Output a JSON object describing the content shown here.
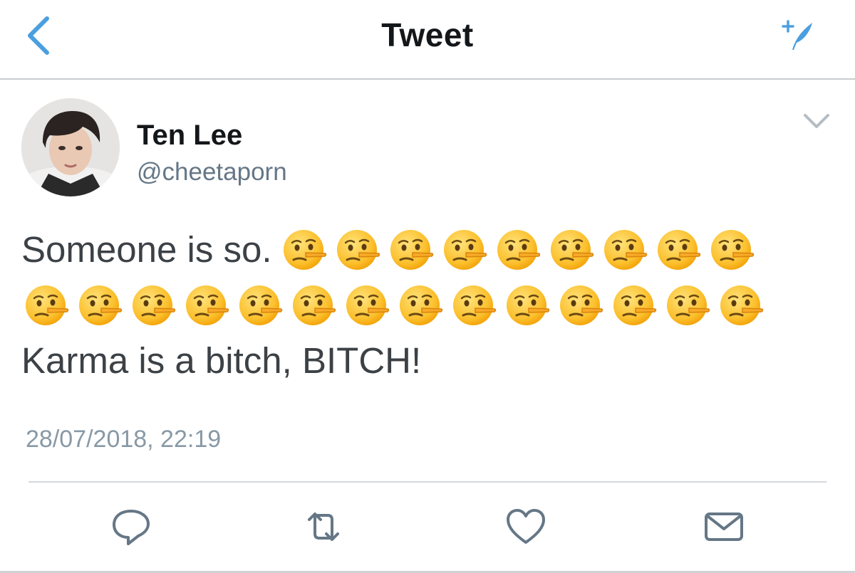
{
  "nav": {
    "title": "Tweet",
    "back_icon": "chevron-left-icon",
    "compose_icon": "compose-tweet-icon",
    "accent": "#4a9fe0"
  },
  "tweet": {
    "display_name": "Ten Lee",
    "handle": "@cheetaporn",
    "text_line1": "Someone is so.",
    "emoji_name": "lying-face-emoji",
    "emoji_count_line1": 9,
    "emoji_count_line2": 14,
    "text_line3": "Karma is a bitch, BITCH!",
    "timestamp": "28/07/2018, 22:19"
  },
  "actions": [
    {
      "name": "reply",
      "icon": "reply-icon"
    },
    {
      "name": "retweet",
      "icon": "retweet-icon"
    },
    {
      "name": "like",
      "icon": "heart-icon"
    },
    {
      "name": "share",
      "icon": "mail-icon"
    }
  ]
}
